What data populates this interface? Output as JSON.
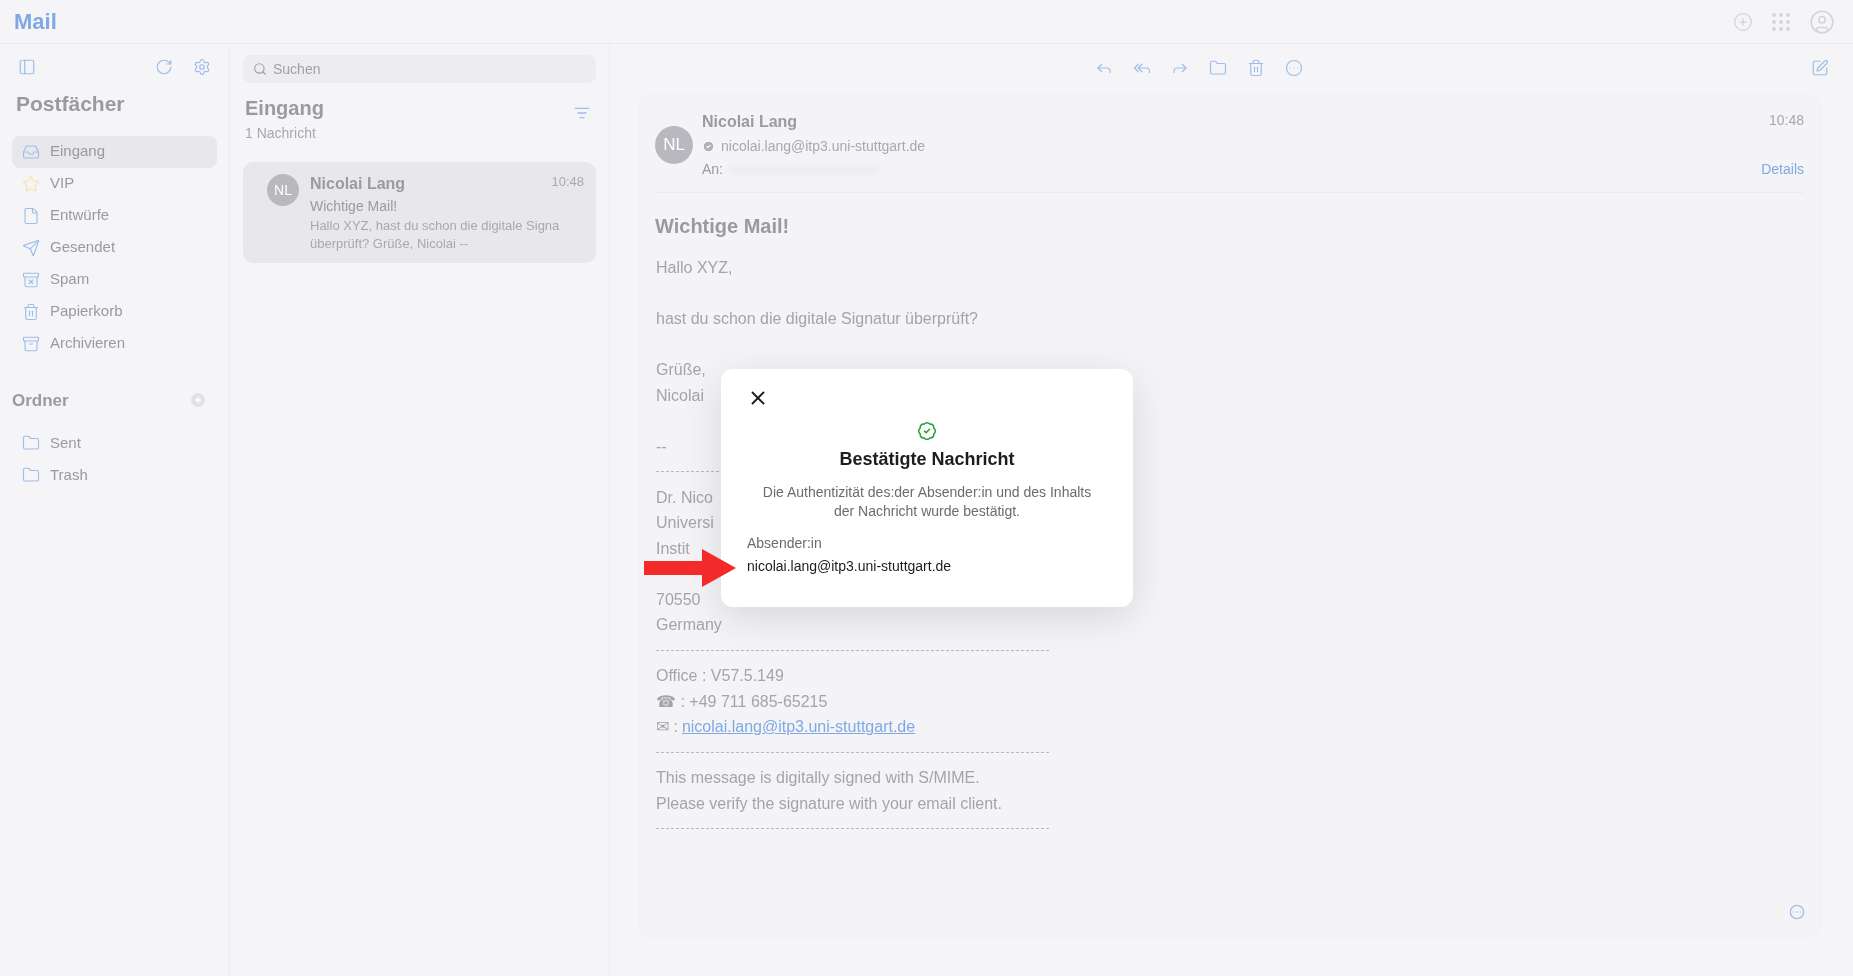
{
  "app": {
    "title": "Mail"
  },
  "sidebar": {
    "heading": "Postfächer",
    "mailboxes": [
      {
        "kind": "inbox",
        "label": "Eingang",
        "selected": true
      },
      {
        "kind": "star",
        "label": "VIP",
        "selected": false
      },
      {
        "kind": "draft",
        "label": "Entwürfe",
        "selected": false
      },
      {
        "kind": "sent",
        "label": "Gesendet",
        "selected": false
      },
      {
        "kind": "spam",
        "label": "Spam",
        "selected": false
      },
      {
        "kind": "trash",
        "label": "Papierkorb",
        "selected": false
      },
      {
        "kind": "archive",
        "label": "Archivieren",
        "selected": false
      }
    ],
    "folders_heading": "Ordner",
    "folders": [
      {
        "label": "Sent"
      },
      {
        "label": "Trash"
      }
    ]
  },
  "message_list": {
    "search": {
      "placeholder": "Suchen"
    },
    "title": "Eingang",
    "count": "1 Nachricht",
    "messages": [
      {
        "initials": "NL",
        "sender": "Nicolai Lang",
        "time": "10:48",
        "subject": "Wichtige Mail!",
        "preview_lines": [
          "Hallo XYZ, hast du schon die digitale Signa",
          "überprüft? Grüße, Nicolai --"
        ],
        "selected": true
      }
    ]
  },
  "reader": {
    "initials": "NL",
    "sender": "Nicolai Lang",
    "email": "nicolai.lang@itp3.uni-stuttgart.de",
    "verified": true,
    "to_label": "An:",
    "time": "10:48",
    "details": "Details",
    "subject": "Wichtige Mail!",
    "body": [
      {
        "kind": "text",
        "text": "Hallo XYZ,"
      },
      {
        "kind": "blank"
      },
      {
        "kind": "text",
        "text": "hast du schon die digitale Signatur überprüft?"
      },
      {
        "kind": "blank"
      },
      {
        "kind": "text",
        "text": "Grüße,"
      },
      {
        "kind": "text",
        "text": "Nicolai"
      },
      {
        "kind": "blank"
      },
      {
        "kind": "text",
        "text": "--"
      },
      {
        "kind": "rule"
      },
      {
        "kind": "text",
        "text": "Dr. Nico"
      },
      {
        "kind": "text",
        "text": "Universi"
      },
      {
        "kind": "text",
        "text": "Instit"
      },
      {
        "kind": "blank"
      },
      {
        "kind": "text",
        "text": "70550"
      },
      {
        "kind": "text",
        "text": "Germany"
      },
      {
        "kind": "rule"
      },
      {
        "kind": "text",
        "text": "Office : V57.5.149"
      },
      {
        "kind": "text",
        "text": "☎ : +49 711 685-65215"
      },
      {
        "kind": "link",
        "text": "✉ :",
        "link": "nicolai.lang@itp3.uni-stuttgart.de"
      },
      {
        "kind": "rule"
      },
      {
        "kind": "text",
        "text": "This message is digitally signed with S/MIME."
      },
      {
        "kind": "text",
        "text": "Please verify the signature with your email client."
      },
      {
        "kind": "rule"
      }
    ]
  },
  "dialog": {
    "title": "Bestätigte Nachricht",
    "description": "Die Authentizität des:der Absender:in und des Inhalts der Nachricht wurde bestätigt.",
    "sender_label": "Absender:in",
    "sender_email": "nicolai.lang@itp3.uni-stuttgart.de"
  }
}
